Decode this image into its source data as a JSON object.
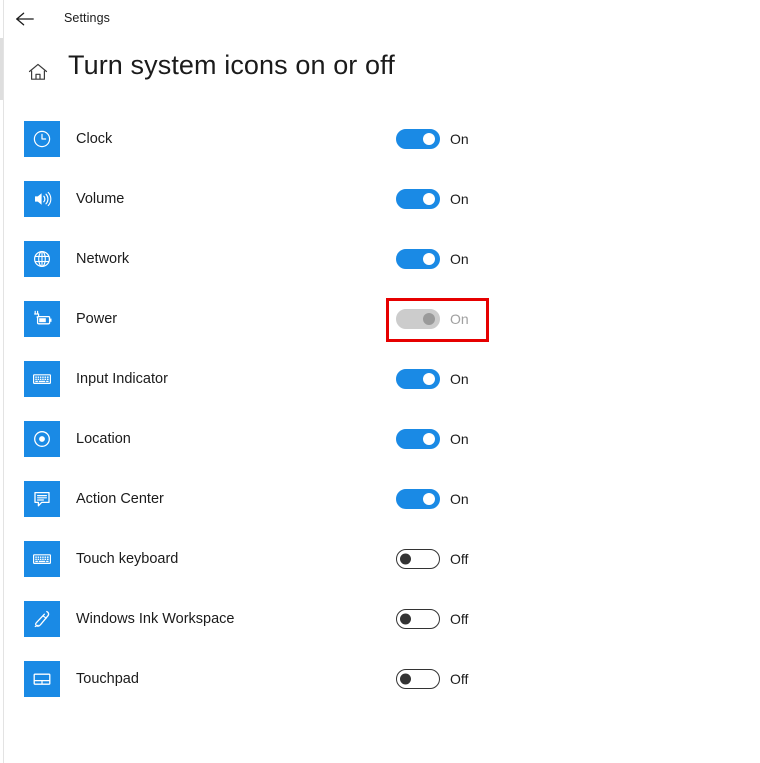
{
  "titlebar": {
    "back_icon": "back-arrow-icon",
    "app_title": "Settings"
  },
  "header": {
    "home_icon": "home-icon",
    "page_title": "Turn system icons on or off"
  },
  "colors": {
    "accent_blue": "#1a8ae5",
    "toggle_off_outline": "#333333",
    "toggle_disabled_track": "#cccccc",
    "toggle_disabled_knob": "#9a9a9a",
    "annotation_red": "#e60000",
    "text_primary": "#1b1b1b",
    "text_disabled": "#a0a0a0"
  },
  "annotation": {
    "target_row": "Power",
    "shape": "rectangle",
    "color": "#e60000"
  },
  "rows": [
    {
      "label": "Clock",
      "icon": "clock-icon",
      "state": "On",
      "toggle": "on"
    },
    {
      "label": "Volume",
      "icon": "volume-icon",
      "state": "On",
      "toggle": "on"
    },
    {
      "label": "Network",
      "icon": "network-globe-icon",
      "state": "On",
      "toggle": "on"
    },
    {
      "label": "Power",
      "icon": "battery-power-icon",
      "state": "On",
      "toggle": "disabled"
    },
    {
      "label": "Input Indicator",
      "icon": "keyboard-icon",
      "state": "On",
      "toggle": "on"
    },
    {
      "label": "Location",
      "icon": "location-target-icon",
      "state": "On",
      "toggle": "on"
    },
    {
      "label": "Action Center",
      "icon": "action-center-icon",
      "state": "On",
      "toggle": "on"
    },
    {
      "label": "Touch keyboard",
      "icon": "touch-keyboard-icon",
      "state": "Off",
      "toggle": "off"
    },
    {
      "label": "Windows Ink Workspace",
      "icon": "pen-icon",
      "state": "Off",
      "toggle": "off"
    },
    {
      "label": "Touchpad",
      "icon": "touchpad-icon",
      "state": "Off",
      "toggle": "off"
    }
  ]
}
